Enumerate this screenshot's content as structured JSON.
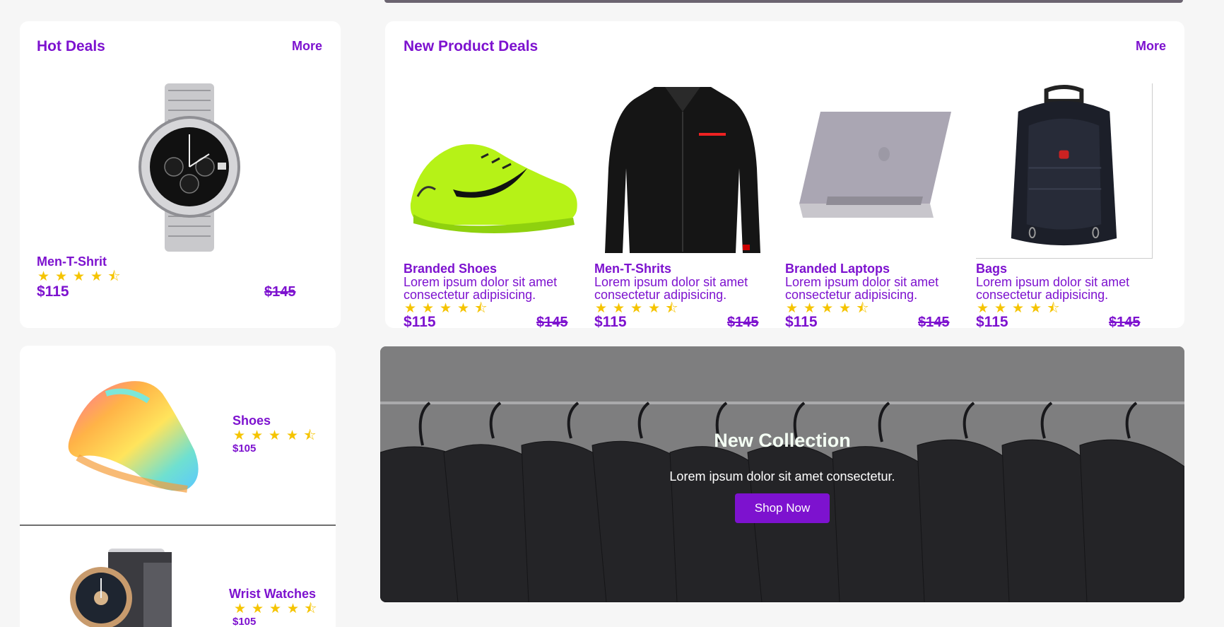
{
  "hot_deals": {
    "title": "Hot Deals",
    "more": "More",
    "product": {
      "name": "Men-T-Shrit",
      "price": "$115",
      "old_price": "$145",
      "rating": 4.5,
      "image": "wrist-watch-image"
    }
  },
  "new_deals": {
    "title": "New Product Deals",
    "more": "More",
    "items": [
      {
        "name": "Branded Shoes",
        "desc": "Lorem ipsum dolor sit amet consectetur adipisicing.",
        "price": "$115",
        "old_price": "$145",
        "rating": 4.5,
        "image": "sneaker-image"
      },
      {
        "name": "Men-T-Shrits",
        "desc": "Lorem ipsum dolor sit amet consectetur adipisicing.",
        "price": "$115",
        "old_price": "$145",
        "rating": 4.5,
        "image": "black-shirt-image"
      },
      {
        "name": "Branded Laptops",
        "desc": "Lorem ipsum dolor sit amet consectetur adipisicing.",
        "price": "$115",
        "old_price": "$145",
        "rating": 4.5,
        "image": "laptop-image"
      },
      {
        "name": "Bags",
        "desc": "Lorem ipsum dolor sit amet consectetur adipisicing.",
        "price": "$115",
        "old_price": "$145",
        "rating": 4.5,
        "image": "backpack-image"
      }
    ]
  },
  "side_list": {
    "items": [
      {
        "name": "Shoes",
        "price": "$105",
        "rating": 4.5,
        "image": "colorful-sneaker-image"
      },
      {
        "name": "Wrist Watches",
        "price": "$105",
        "rating": 4.5,
        "image": "wrist-watch-image"
      }
    ]
  },
  "banner": {
    "title": "New Collection",
    "subtitle": "Lorem ipsum dolor sit amet consectetur.",
    "button": "Shop Now"
  },
  "icons": {
    "star": "★",
    "half_star": "⯪"
  },
  "colors": {
    "accent": "#7d12cf",
    "star": "#f5c400",
    "background": "#f6f6f6"
  }
}
